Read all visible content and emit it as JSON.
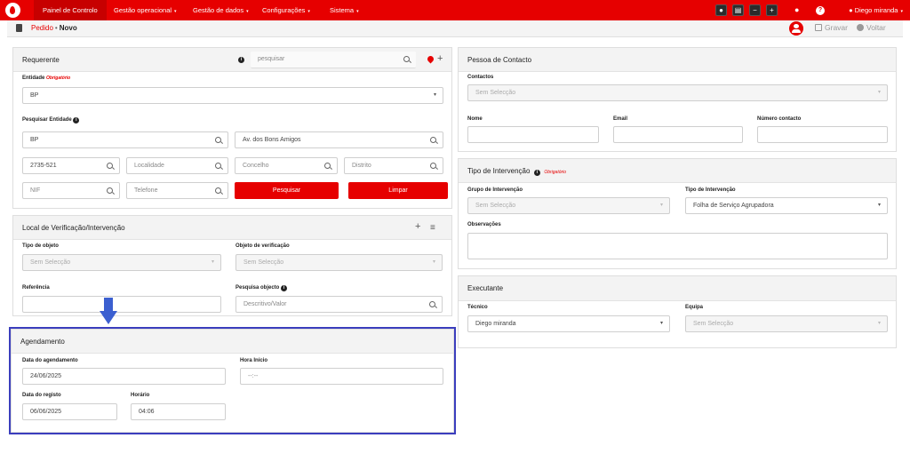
{
  "nav": {
    "home": "Painel de Controlo",
    "items": [
      "Gestão operacional",
      "Gestão de dados",
      "Configurações",
      "Sistema"
    ],
    "caret": "▾",
    "user": "Diego miranda",
    "icons": [
      "chat-icon",
      "id-card-icon",
      "minus-icon",
      "plus-icon",
      "bell-icon",
      "help-icon",
      "user-icon"
    ]
  },
  "breadcrumb": {
    "link": "Pedido",
    "sep": "•",
    "current": "Novo"
  },
  "actions": {
    "save": "Gravar",
    "back": "Voltar"
  },
  "requerente": {
    "title": "Requerente",
    "search_placeholder": "pesquisar",
    "entidade_label": "Entidade",
    "required": "Obrigatório",
    "entidade_value": "BP",
    "pesquisar_entidade_label": "Pesquisar Entidade",
    "nome": "BP",
    "morada": "Av. dos Bons Amigos",
    "codigo_postal": "2735-521",
    "localidade_ph": "Localidade",
    "concelho_ph": "Concelho",
    "distrito_ph": "Distrito",
    "nif_ph": "NIF",
    "telefone_ph": "Telefone",
    "pesquisar_btn": "Pesquisar",
    "limpar_btn": "Limpar"
  },
  "local": {
    "title": "Local de Verificação/Intervenção",
    "tipo_objeto_label": "Tipo de objeto",
    "tipo_objeto_value": "Sem Selecção",
    "objeto_verificacao_label": "Objeto de verificação",
    "objeto_verificacao_value": "Sem Selecção",
    "referencia_label": "Referência",
    "pesquisa_objecto_label": "Pesquisa objecto",
    "pesquisa_objecto_ph": "Descritivo/Valor"
  },
  "agendamento": {
    "title": "Agendamento",
    "data_agendamento_label": "Data do agendamento",
    "data_agendamento_value": "24/06/2025",
    "hora_inicio_label": "Hora Início",
    "hora_inicio_value": "--:--",
    "data_registo_label": "Data do registo",
    "data_registo_value": "06/06/2025",
    "horario_label": "Horário",
    "horario_value": "04:06"
  },
  "contacto": {
    "title": "Pessoa de Contacto",
    "contactos_label": "Contactos",
    "contactos_value": "Sem Selecção",
    "nome_label": "Nome",
    "email_label": "Email",
    "numero_label": "Número contacto"
  },
  "intervencao": {
    "title": "Tipo de Intervenção",
    "required": "Obrigatório",
    "grupo_label": "Grupo de Intervenção",
    "grupo_value": "Sem Selecção",
    "tipo_label": "Tipo de Intervenção",
    "tipo_value": "Folha de Serviço Agrupadora",
    "observacoes_label": "Observações"
  },
  "executante": {
    "title": "Executante",
    "tecnico_label": "Técnico",
    "tecnico_value": "Diego miranda",
    "equipa_label": "Equipa",
    "equipa_value": "Sem Selecção"
  },
  "annotation": {
    "arrow_color": "#3b5fd0",
    "box_color": "#3b3ebd"
  },
  "brand_color": "#e60000"
}
